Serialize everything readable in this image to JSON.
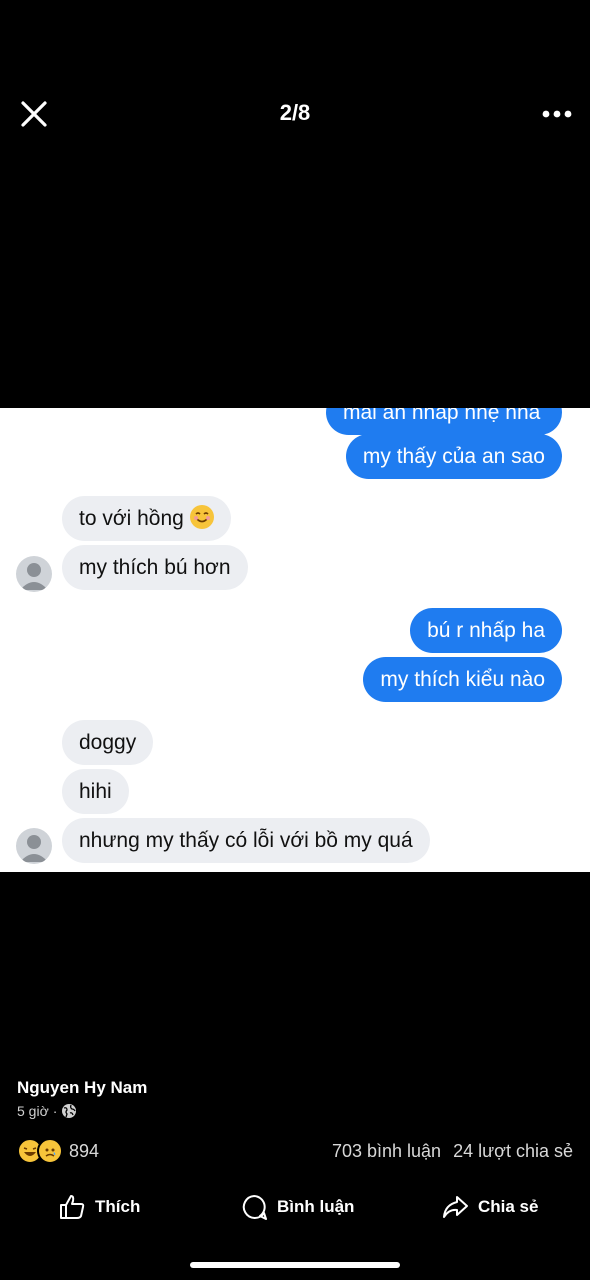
{
  "header": {
    "counter": "2/8",
    "close_icon": "close-icon",
    "more_icon": "more-icon"
  },
  "conversation": {
    "outgoing_color": "#1f7cf0",
    "incoming_color": "#eceef2",
    "messages": [
      {
        "side": "out",
        "text": "mai an nhấp nhẹ nha"
      },
      {
        "side": "out",
        "text": "my thấy của an sao"
      },
      {
        "side": "in",
        "text": "to với hồng"
      },
      {
        "side": "in",
        "text": "my thích bú hơn"
      },
      {
        "side": "out",
        "text": "bú r nhấp ha"
      },
      {
        "side": "out",
        "text": "my thích kiểu nào"
      },
      {
        "side": "in",
        "text": "doggy"
      },
      {
        "side": "in",
        "text": "hihi"
      },
      {
        "side": "in",
        "text": "nhưng my thấy có lỗi với bồ my quá"
      }
    ]
  },
  "post": {
    "author": "Nguyen Hy Nam",
    "time": "5 giờ",
    "reaction_count": "894",
    "comments": "703 bình luận",
    "shares": "24 lượt chia sẻ"
  },
  "actions": {
    "like": "Thích",
    "comment": "Bình luận",
    "share": "Chia sẻ"
  }
}
